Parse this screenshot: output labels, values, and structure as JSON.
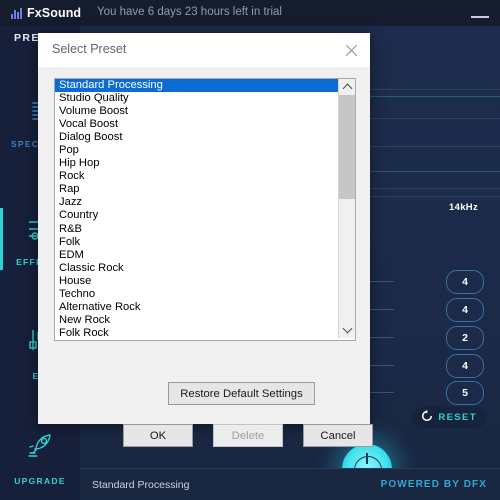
{
  "titlebar": {
    "brand": "FxSound",
    "trial_text": "You have 6 days 23 hours left in trial",
    "minimize_label": "Minimize"
  },
  "sidebar": {
    "preset_label": "PRESET",
    "items": [
      {
        "label": "SPECTRUM",
        "icon": "spectrum-icon",
        "active": false
      },
      {
        "label": "EFFECTS",
        "icon": "sliders-icon",
        "active": true
      },
      {
        "label": "EQ",
        "icon": "equalizer-icon",
        "active": false
      },
      {
        "label": "UPGRADE",
        "icon": "rocket-icon",
        "active": false
      }
    ]
  },
  "main": {
    "frequency_label": "14kHz",
    "band_values": [
      "4",
      "4",
      "2",
      "4",
      "5"
    ],
    "reset_label": "RESET",
    "reset_icon": "refresh-icon",
    "power_button_label": "Power",
    "accent_color": "#2fd2d2",
    "selection_color": "#0a6cd4"
  },
  "statusbar": {
    "current_preset": "Standard Processing",
    "powered_by": "POWERED BY DFX"
  },
  "dialog": {
    "title": "Select Preset",
    "close_icon": "close-icon",
    "scrollbar": {
      "up_icon": "chevron-up-icon",
      "down_icon": "chevron-down-icon"
    },
    "presets": [
      "Standard Processing",
      "Studio Quality",
      "Volume Boost",
      "Vocal Boost",
      "Dialog Boost",
      "Pop",
      "Hip Hop",
      "Rock",
      "Rap",
      "Jazz",
      "Country",
      "R&B",
      "Folk",
      "EDM",
      "Classic Rock",
      "House",
      "Techno",
      "Alternative Rock",
      "New Rock",
      "Folk Rock"
    ],
    "selected_preset": "Standard Processing",
    "buttons": {
      "restore": "Restore Default Settings",
      "ok": "OK",
      "delete": "Delete",
      "cancel": "Cancel"
    }
  }
}
